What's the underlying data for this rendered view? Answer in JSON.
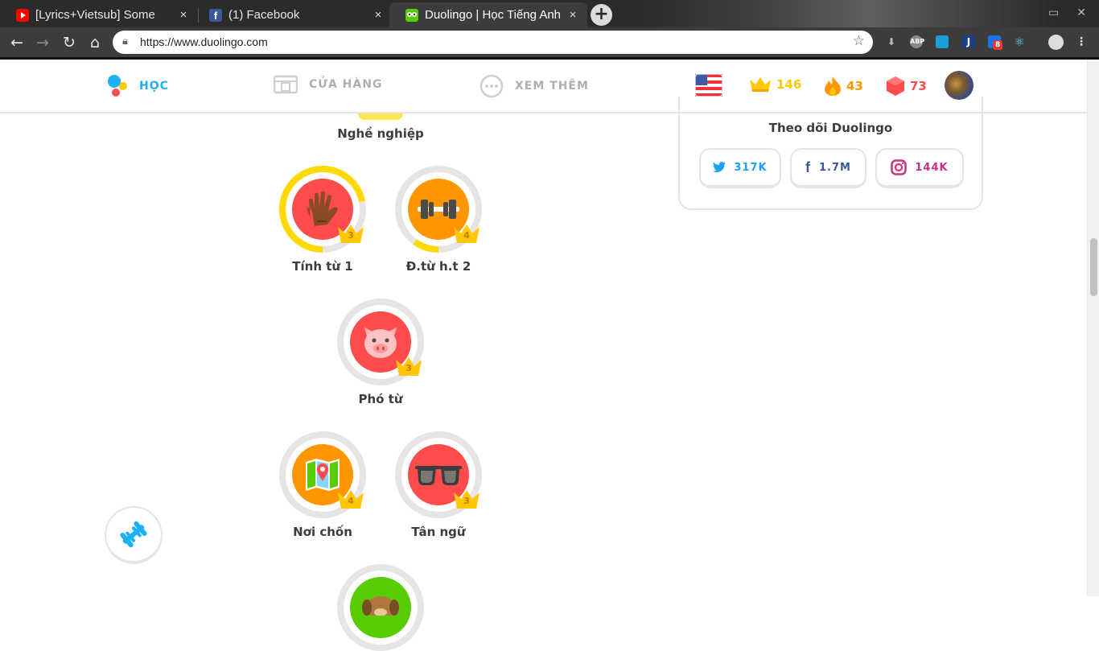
{
  "browser": {
    "tabs": [
      {
        "title": "[Lyrics+Vietsub] Some",
        "close": "×"
      },
      {
        "title": "(1) Facebook",
        "close": "×"
      },
      {
        "title": "Duolingo | Học Tiếng Anh",
        "close": "×"
      }
    ],
    "new_tab": "+",
    "url": "https://www.duolingo.com",
    "extension_badge": "8",
    "abp_label": "ABP"
  },
  "header": {
    "nav": [
      {
        "label": "HỌC",
        "color": "#1cb0f6"
      },
      {
        "label": "CỬA HÀNG",
        "color": "#afafaf"
      },
      {
        "label": "XEM THÊM",
        "color": "#afafaf"
      }
    ],
    "stats": {
      "crowns": "146",
      "streak": "43",
      "gems": "73"
    }
  },
  "skills": [
    {
      "label": "Nghề nghiệp"
    },
    {
      "label": "Tính từ 1",
      "crown": "3",
      "color": "#ff4b4b",
      "icon": "hand-icon",
      "progress": 0.72
    },
    {
      "label": "Đ.từ h.t 2",
      "crown": "4",
      "color": "#ff9600",
      "icon": "dumbbell-icon",
      "progress": 0.1
    },
    {
      "label": "Phó từ",
      "crown": "3",
      "color": "#ff4b4b",
      "icon": "pig-icon",
      "progress": 0
    },
    {
      "label": "Nơi chốn",
      "crown": "4",
      "color": "#ff9600",
      "icon": "map-icon",
      "progress": 0
    },
    {
      "label": "Tân ngữ",
      "crown": "3",
      "color": "#ff4b4b",
      "icon": "sunglasses-icon",
      "progress": 0
    }
  ],
  "panel": {
    "title": "Theo dõi Duolingo",
    "social": [
      {
        "name": "twitter",
        "count": "317K",
        "color": "#1da1f2"
      },
      {
        "name": "facebook",
        "count": "1.7M",
        "color": "#3b5998"
      },
      {
        "name": "instagram",
        "count": "144K",
        "color": "#c13584"
      }
    ]
  },
  "colors": {
    "accent": "#1cb0f6",
    "gold": "#ffc800",
    "streak": "#ff9600",
    "gem": "#ff4b4b"
  }
}
